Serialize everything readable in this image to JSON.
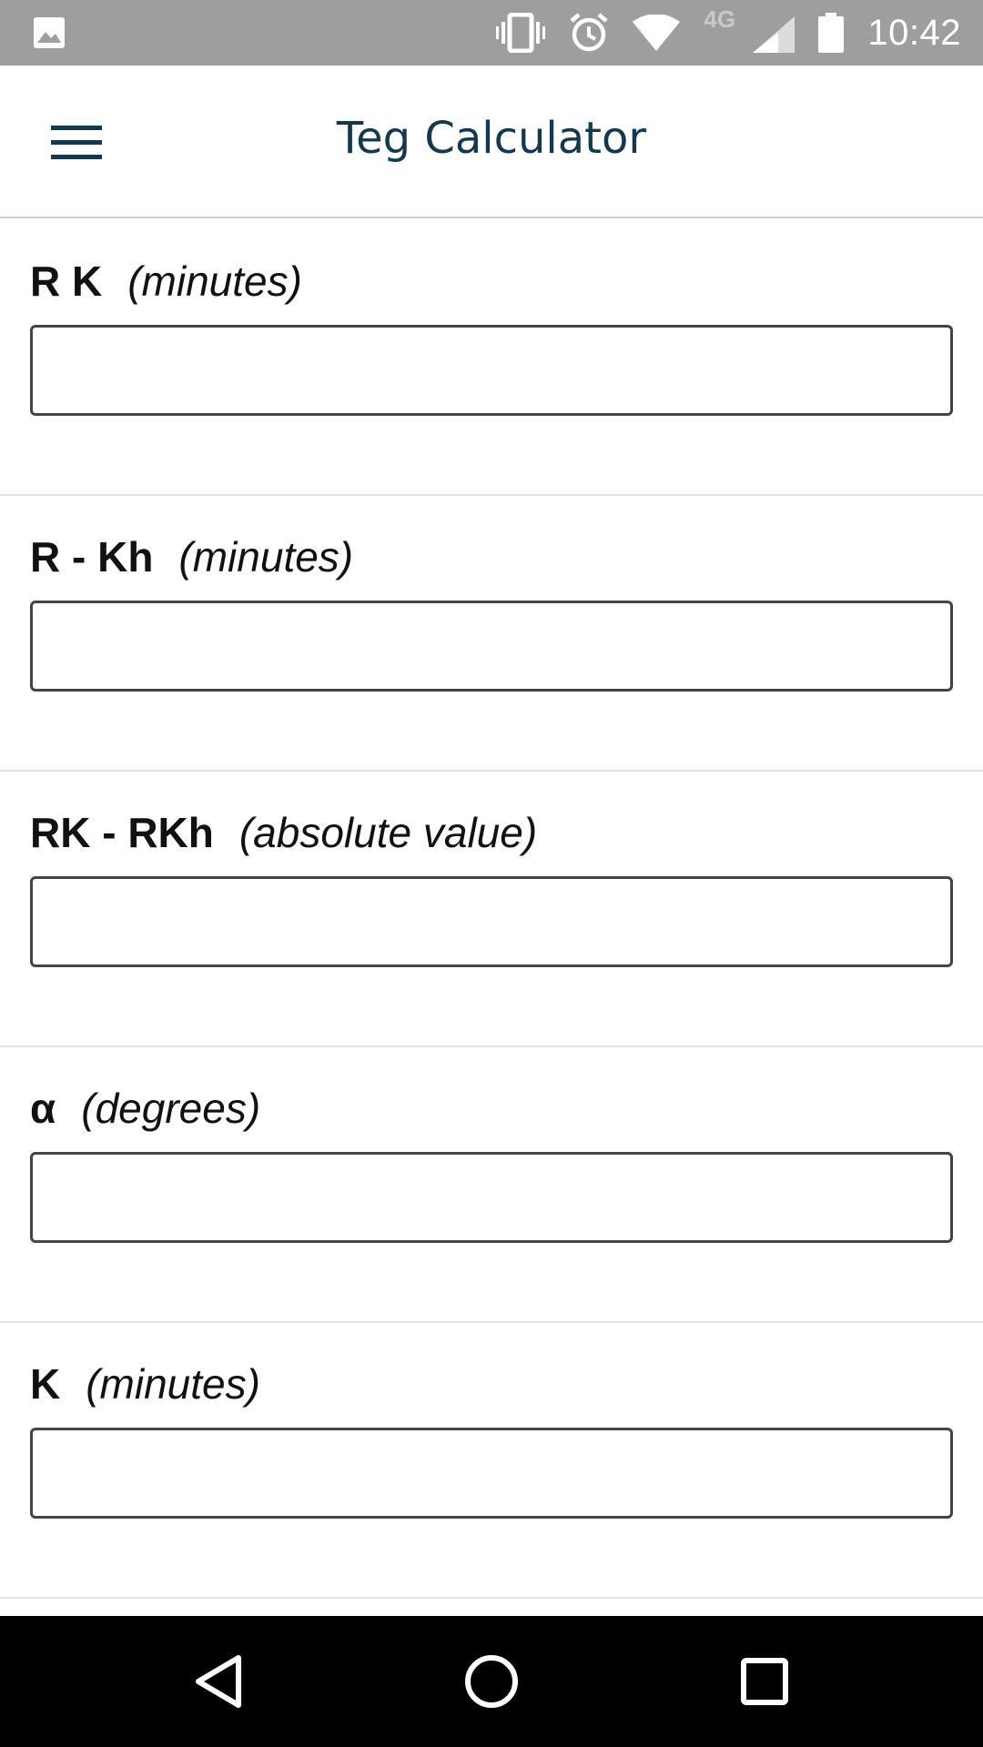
{
  "status_bar": {
    "time": "10:42",
    "network": "4G",
    "icons": [
      "image-icon",
      "vibrate-icon",
      "alarm-icon",
      "wifi-icon",
      "cell-signal-icon",
      "battery-icon"
    ]
  },
  "app_bar": {
    "title": "Teg Calculator",
    "menu_icon": "hamburger-menu-icon"
  },
  "fields": [
    {
      "name": "R K",
      "unit": "(minutes)",
      "value": ""
    },
    {
      "name": "R - Kh",
      "unit": "(minutes)",
      "value": ""
    },
    {
      "name": "RK - RKh",
      "unit": "(absolute value)",
      "value": ""
    },
    {
      "name": "α",
      "unit": "(degrees)",
      "value": ""
    },
    {
      "name": "K",
      "unit": "(minutes)",
      "value": ""
    }
  ],
  "nav_bar": {
    "icons": [
      "back-icon",
      "home-icon",
      "recents-icon"
    ]
  },
  "colors": {
    "status_bar_bg": "#9e9e9e",
    "title": "#0f3a52",
    "nav_bar_bg": "#000000"
  }
}
